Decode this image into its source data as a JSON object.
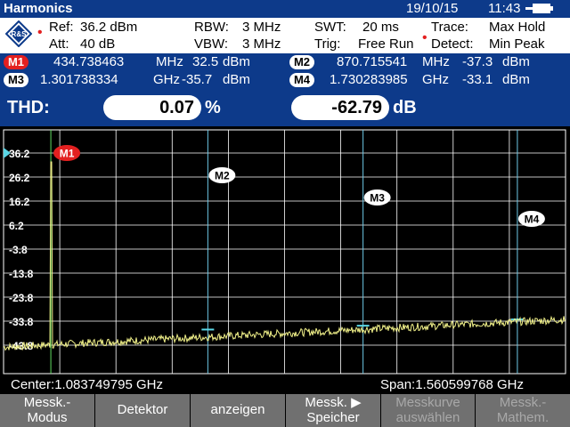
{
  "titlebar": {
    "title": "Harmonics",
    "date": "19/10/15",
    "time": "11:43"
  },
  "params": {
    "ref_label": "Ref:",
    "ref_value": "36.2 dBm",
    "att_label": "Att:",
    "att_value": "40 dB",
    "rbw_label": "RBW:",
    "rbw_value": "3 MHz",
    "vbw_label": "VBW:",
    "vbw_value": "3 MHz",
    "swt_label": "SWT:",
    "swt_value": "20 ms",
    "trig_label": "Trig:",
    "trig_value": "Free Run",
    "trace_label": "Trace:",
    "trace_value": "Max Hold",
    "detect_label": "Detect:",
    "detect_value": "Min Peak"
  },
  "markers": [
    {
      "id": "M1",
      "freq": "434.738463",
      "freq_unit": "MHz",
      "level": "32.5",
      "level_unit": "dBm"
    },
    {
      "id": "M2",
      "freq": "870.715541",
      "freq_unit": "MHz",
      "level": "-37.3",
      "level_unit": "dBm"
    },
    {
      "id": "M3",
      "freq": "1.301738334",
      "freq_unit": "GHz",
      "level": "-35.7",
      "level_unit": "dBm"
    },
    {
      "id": "M4",
      "freq": "1.730283985",
      "freq_unit": "GHz",
      "level": "-33.1",
      "level_unit": "dBm"
    }
  ],
  "thd": {
    "label": "THD:",
    "percent_value": "0.07",
    "percent_unit": "%",
    "db_value": "-62.79",
    "db_unit": "dB"
  },
  "plot": {
    "y_tick_labels": [
      "36.2",
      "26.2",
      "16.2",
      "6.2",
      "-3.8",
      "-13.8",
      "-23.8",
      "-33.8",
      "-43.8"
    ],
    "marker_labels": [
      "M1",
      "M2",
      "M3",
      "M4"
    ]
  },
  "bottom": {
    "center": "Center:1.083749795 GHz",
    "span": "Span:1.560599768 GHz"
  },
  "softkeys": [
    {
      "line1": "Messk.-",
      "line2": "Modus"
    },
    {
      "line1": "Detektor",
      "line2": ""
    },
    {
      "line1": "anzeigen",
      "line2": ""
    },
    {
      "line1": "Messk. ▶",
      "line2": "Speicher"
    },
    {
      "line1": "Messkurve",
      "line2": "auswählen"
    },
    {
      "line1": "Messk.-",
      "line2": "Mathem."
    }
  ],
  "colors": {
    "title_bg": "#0d3a8a",
    "trace": "#f2f28a",
    "marker_line": "#6ec8e6",
    "m1_line": "#5fdc5f",
    "marker_red": "#e32020",
    "softkey_bg": "#707070"
  },
  "chart_data": {
    "type": "line",
    "x_unit": "GHz",
    "y_unit": "dBm",
    "ylim": [
      -46.8,
      36.2
    ],
    "xlim": [
      0.30345,
      1.86405
    ],
    "series": [
      {
        "x": [
          0.30345,
          0.42,
          0.4347,
          0.45,
          0.8707,
          1.3017,
          1.7303,
          1.86405
        ],
        "values": [
          -44.5,
          -44.3,
          32.5,
          -43.8,
          -37.3,
          -35.7,
          -33.1,
          -33.0
        ]
      }
    ],
    "markers": [
      {
        "name": "M1",
        "x": 0.434738463,
        "y": 32.5
      },
      {
        "name": "M2",
        "x": 0.870715541,
        "y": -37.3
      },
      {
        "name": "M3",
        "x": 1.301738334,
        "y": -35.7
      },
      {
        "name": "M4",
        "x": 1.730283985,
        "y": -33.1
      }
    ],
    "grid": true
  }
}
